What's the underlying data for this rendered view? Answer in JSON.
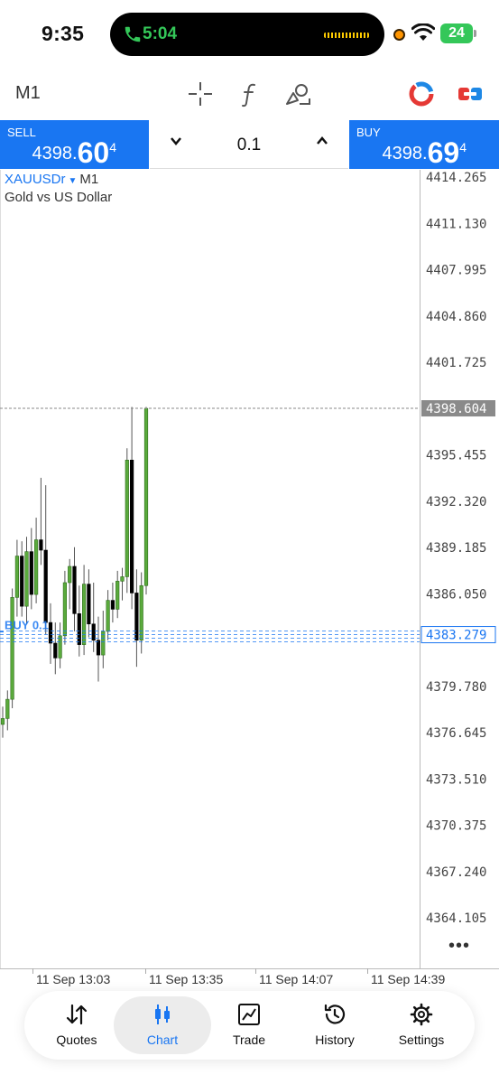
{
  "status_bar": {
    "time": "9:35",
    "call_time": "5:04",
    "battery": "24"
  },
  "toolbar": {
    "timeframe": "M1",
    "icons": [
      "crosshair-icon",
      "indicators-icon",
      "objects-icon",
      "color-scheme-icon",
      "trade-mode-icon"
    ]
  },
  "trade_bar": {
    "sell_label": "SELL",
    "sell_price_prefix": "4398.",
    "sell_price_big": "60",
    "sell_price_sup": "4",
    "lot": "0.1",
    "buy_label": "BUY",
    "buy_price_prefix": "4398.",
    "buy_price_big": "69",
    "buy_price_sup": "4"
  },
  "chart": {
    "symbol": "XAUUSDr",
    "timeframe": "M1",
    "description": "Gold vs US Dollar",
    "price_levels": [
      "4414.265",
      "4411.130",
      "4407.995",
      "4404.860",
      "4401.725",
      "4398.604",
      "4395.455",
      "4392.320",
      "4389.185",
      "4386.050",
      "4383.279",
      "4379.780",
      "4376.645",
      "4373.510",
      "4370.375",
      "4367.240",
      "4364.105"
    ],
    "current_price_label": "4398.604",
    "order_price_label": "4383.279",
    "order_line_label": "BUY 0.1",
    "time_labels": [
      "11 Sep 13:03",
      "11 Sep 13:35",
      "11 Sep 14:07",
      "11 Sep 14:39"
    ]
  },
  "chart_data": {
    "type": "candlestick",
    "symbol": "XAUUSDr",
    "timeframe": "M1",
    "ylim": [
      4362.5,
      4415.5
    ],
    "current_price": 4398.604,
    "order_line": {
      "label": "BUY 0.1",
      "price": 4383.279
    },
    "colors": {
      "up": "#5aaa3c",
      "down": "#000000",
      "wick": "#555555",
      "grid_line": "#888888",
      "order_line": "#1976f2"
    },
    "candles": [
      {
        "o": 4377.2,
        "h": 4378.4,
        "l": 4376.3,
        "c": 4377.6
      },
      {
        "o": 4377.6,
        "h": 4379.5,
        "l": 4376.8,
        "c": 4378.9
      },
      {
        "o": 4378.9,
        "h": 4386.4,
        "l": 4378.3,
        "c": 4385.8
      },
      {
        "o": 4385.8,
        "h": 4389.7,
        "l": 4384.5,
        "c": 4388.6
      },
      {
        "o": 4388.6,
        "h": 4389.6,
        "l": 4384.5,
        "c": 4385.2
      },
      {
        "o": 4385.2,
        "h": 4389.9,
        "l": 4384.0,
        "c": 4388.9
      },
      {
        "o": 4388.9,
        "h": 4390.5,
        "l": 4385.0,
        "c": 4386.0
      },
      {
        "o": 4386.0,
        "h": 4391.2,
        "l": 4385.4,
        "c": 4389.7
      },
      {
        "o": 4389.7,
        "h": 4393.9,
        "l": 4388.0,
        "c": 4389.0
      },
      {
        "o": 4389.0,
        "h": 4393.4,
        "l": 4383.3,
        "c": 4384.1
      },
      {
        "o": 4384.1,
        "h": 4385.4,
        "l": 4381.3,
        "c": 4382.7
      },
      {
        "o": 4382.7,
        "h": 4384.1,
        "l": 4380.6,
        "c": 4381.7
      },
      {
        "o": 4381.7,
        "h": 4384.1,
        "l": 4381.0,
        "c": 4383.2
      },
      {
        "o": 4383.2,
        "h": 4387.6,
        "l": 4382.6,
        "c": 4386.8
      },
      {
        "o": 4386.8,
        "h": 4388.4,
        "l": 4385.0,
        "c": 4387.9
      },
      {
        "o": 4387.9,
        "h": 4389.2,
        "l": 4383.5,
        "c": 4384.7
      },
      {
        "o": 4384.7,
        "h": 4386.6,
        "l": 4381.8,
        "c": 4382.6
      },
      {
        "o": 4382.6,
        "h": 4388.0,
        "l": 4381.9,
        "c": 4386.7
      },
      {
        "o": 4386.7,
        "h": 4387.7,
        "l": 4383.1,
        "c": 4384.0
      },
      {
        "o": 4384.0,
        "h": 4386.8,
        "l": 4382.1,
        "c": 4382.9
      },
      {
        "o": 4382.9,
        "h": 4384.5,
        "l": 4380.1,
        "c": 4381.9
      },
      {
        "o": 4381.9,
        "h": 4384.9,
        "l": 4381.0,
        "c": 4383.5
      },
      {
        "o": 4383.5,
        "h": 4386.3,
        "l": 4382.9,
        "c": 4385.6
      },
      {
        "o": 4385.6,
        "h": 4386.8,
        "l": 4384.1,
        "c": 4385.0
      },
      {
        "o": 4385.0,
        "h": 4387.6,
        "l": 4384.4,
        "c": 4386.9
      },
      {
        "o": 4386.9,
        "h": 4387.8,
        "l": 4385.6,
        "c": 4387.2
      },
      {
        "o": 4387.2,
        "h": 4395.9,
        "l": 4386.1,
        "c": 4395.1
      },
      {
        "o": 4395.1,
        "h": 4398.7,
        "l": 4385.0,
        "c": 4386.1
      },
      {
        "o": 4386.1,
        "h": 4387.7,
        "l": 4381.1,
        "c": 4382.9
      },
      {
        "o": 4382.9,
        "h": 4387.5,
        "l": 4382.0,
        "c": 4386.6
      },
      {
        "o": 4386.6,
        "h": 4398.7,
        "l": 4386.0,
        "c": 4398.6
      }
    ]
  },
  "bottom_nav": {
    "items": [
      {
        "label": "Quotes",
        "icon": "quotes-icon"
      },
      {
        "label": "Chart",
        "icon": "chart-icon"
      },
      {
        "label": "Trade",
        "icon": "trade-icon"
      },
      {
        "label": "History",
        "icon": "history-icon"
      },
      {
        "label": "Settings",
        "icon": "settings-icon"
      }
    ],
    "active": "Chart"
  }
}
